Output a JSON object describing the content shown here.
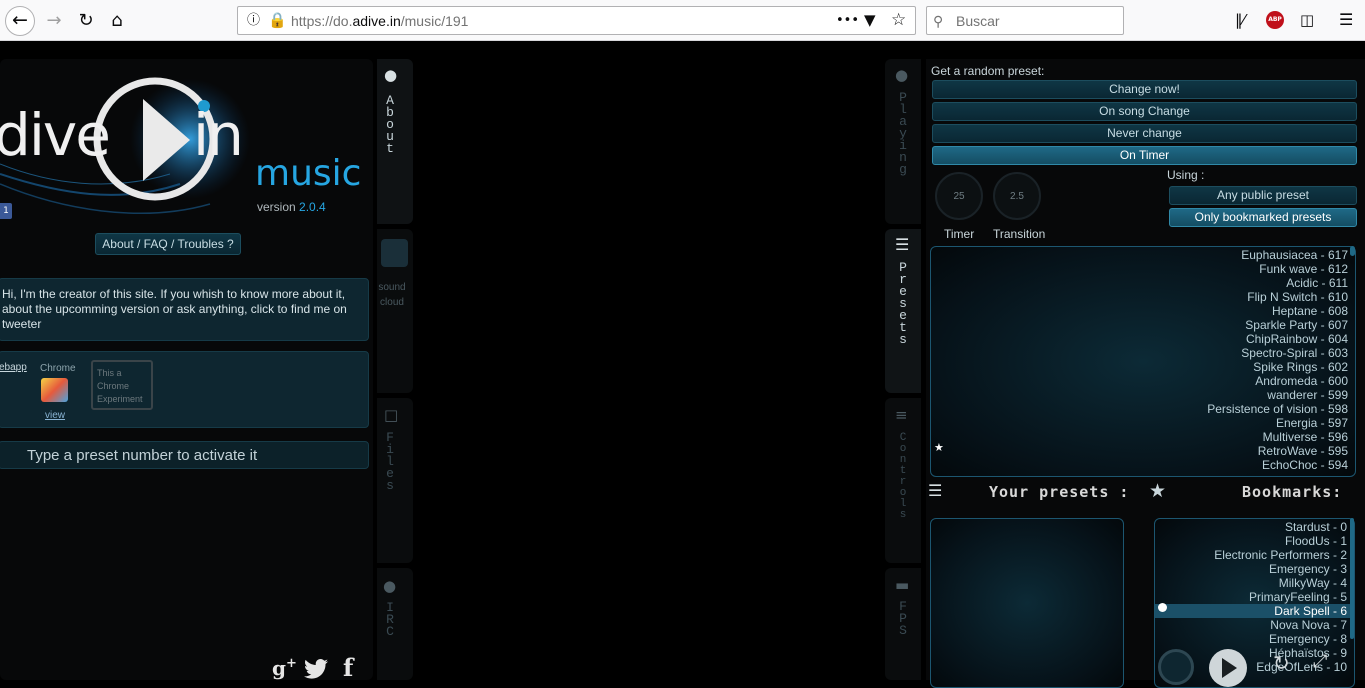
{
  "browser": {
    "url_prefix": "https://do.",
    "url_domain": "adive.in",
    "url_path": "/music/191",
    "search_placeholder": "Buscar",
    "abp_label": "ABP",
    "page_actions": "•••"
  },
  "left": {
    "logo_text": "dive",
    "logo_in": "in",
    "logo_music": "music",
    "version_label": "version",
    "version_number": "2.0.4",
    "badge": "1",
    "about_button": "About / FAQ / Troubles ?",
    "creator_text": "Hi, I'm the creator of this site. If you whish to know more about it, about the upcomming version or ask anything, click to find me on tweeter",
    "webapp_label": "ebapp",
    "chrome_label": "Chrome",
    "view_link": "view",
    "experiment_text": "This a Chrome Experiment",
    "preset_input_placeholder": "Type a preset number to activate it"
  },
  "left_tabs": {
    "about": "About",
    "soundcloud_1": "sound",
    "soundcloud_2": "cloud",
    "files": "Files",
    "irc": "IRC"
  },
  "right_tabs": {
    "playing": "Playing",
    "presets": "Presets",
    "controls": "Controls",
    "fps": "FPS"
  },
  "random": {
    "title": "Get a random preset:",
    "buttons": [
      "Change now!",
      "On song Change",
      "Never change",
      "On Timer"
    ],
    "active_index": 3,
    "using_label": "Using :",
    "using_buttons": [
      "Any public preset",
      "Only bookmarked presets"
    ],
    "using_active_index": 1,
    "timer_value": "25",
    "transition_value": "2.5",
    "timer_label": "Timer",
    "transition_label": "Transition"
  },
  "presets_list": [
    "Euphausiacea - 617",
    "Funk wave - 612",
    "Acidic - 611",
    "Flip N Switch - 610",
    "Heptane - 608",
    "Sparkle Party - 607",
    "ChipRainbow - 604",
    "Spectro-Spiral - 603",
    "Spike Rings - 602",
    "Andromeda - 600",
    "wanderer - 599",
    "Persistence of vision - 598",
    "Energia - 597",
    "Multiverse - 596",
    "RetroWave - 595",
    "EchoChoc - 594"
  ],
  "your_presets_label": "Your presets :",
  "bookmarks_label": "Bookmarks:",
  "bookmarks_list": [
    "Stardust - 0",
    "FloodUs - 1",
    "Electronic Performers - 2",
    "Emergency - 3",
    "MilkyWay - 4",
    "PrimaryFeeling - 5",
    "Dark Spell - 6",
    "Nova Nova - 7",
    "Emergency - 8",
    "Héphaïstos - 9",
    "EdgeOfLens - 10"
  ],
  "bookmarks_selected_index": 6,
  "colors": {
    "accent": "#1f9ad0",
    "panel": "#0b0d0f",
    "button": "#0f3645",
    "button_active": "#1f6986"
  }
}
